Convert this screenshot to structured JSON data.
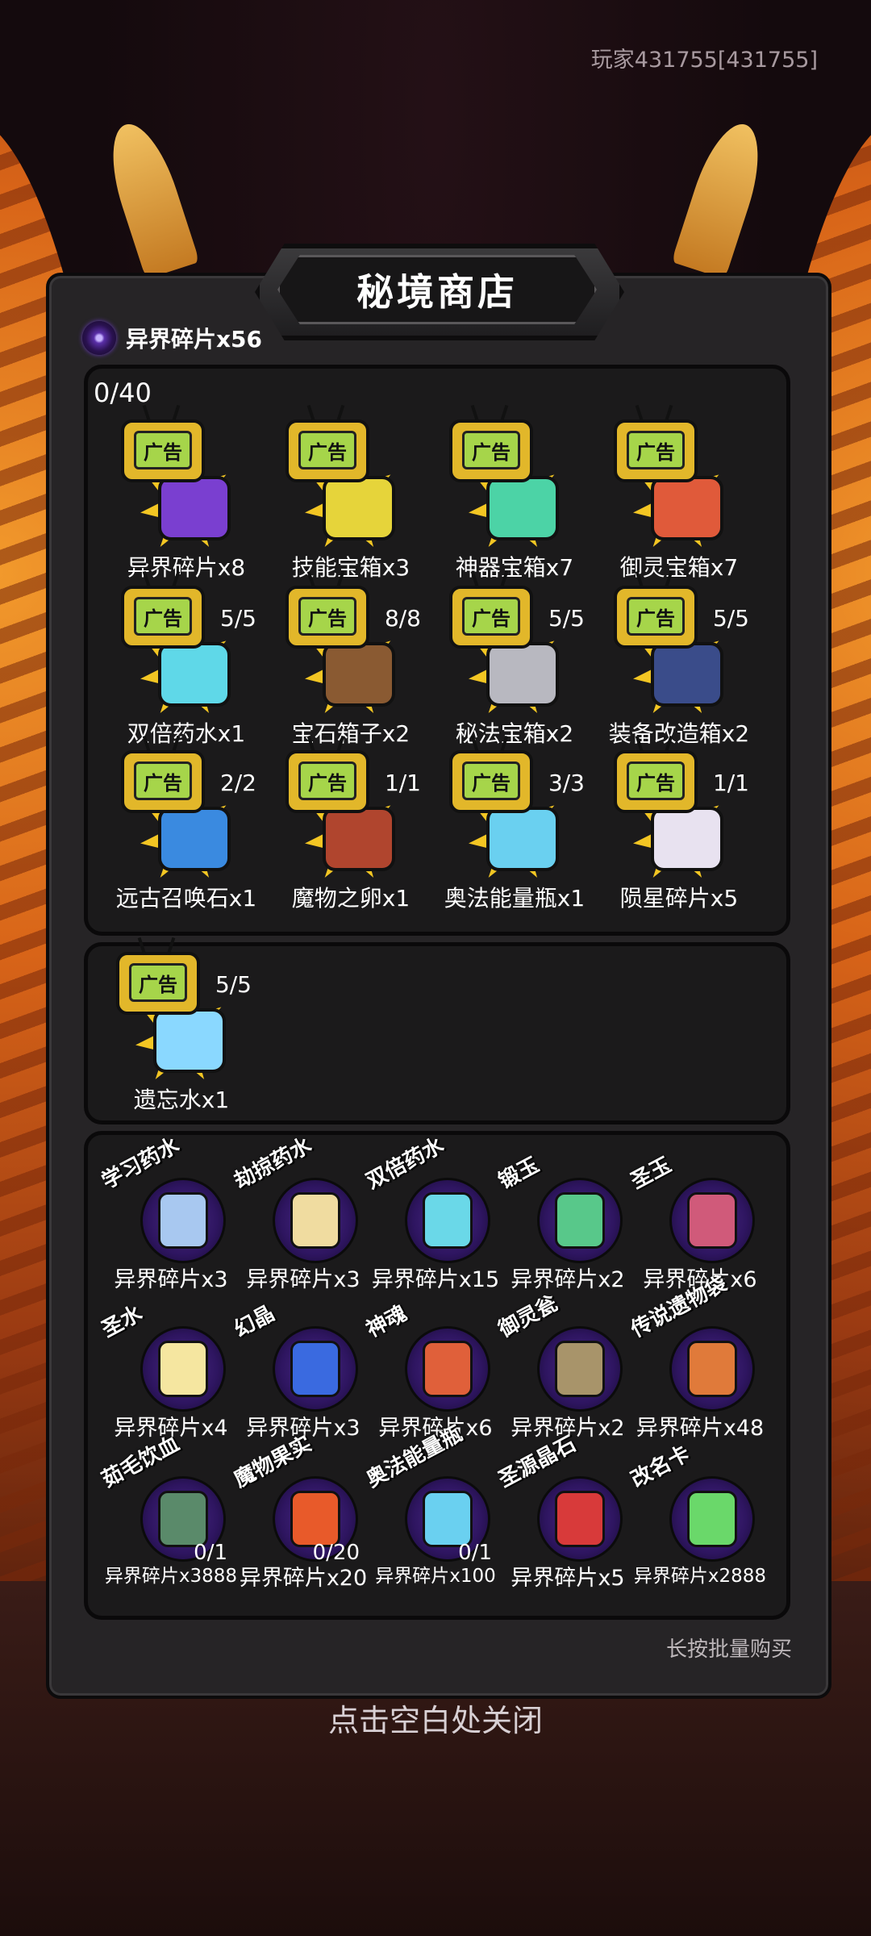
{
  "player": "玩家431755[431755]",
  "title": "秘境商店",
  "currency": {
    "label": "异界碎片x56"
  },
  "ad_section": {
    "counter": "0/40",
    "badge": "广告",
    "items": [
      {
        "name": "异界碎片x8",
        "qty": "",
        "color": "#7a3fd0"
      },
      {
        "name": "技能宝箱x3",
        "qty": "",
        "color": "#e6d43a"
      },
      {
        "name": "神器宝箱x7",
        "qty": "",
        "color": "#4cd3a6"
      },
      {
        "name": "御灵宝箱x7",
        "qty": "",
        "color": "#e05a3a"
      },
      {
        "name": "双倍药水x1",
        "qty": "5/5",
        "color": "#5fd8e8"
      },
      {
        "name": "宝石箱子x2",
        "qty": "8/8",
        "color": "#8a5a32"
      },
      {
        "name": "秘法宝箱x2",
        "qty": "5/5",
        "color": "#b8b8c0"
      },
      {
        "name": "装备改造箱x2",
        "qty": "5/5",
        "color": "#3a4c8a"
      },
      {
        "name": "远古召唤石x1",
        "qty": "2/2",
        "color": "#3a8ae0"
      },
      {
        "name": "魔物之卵x1",
        "qty": "1/1",
        "color": "#b0452e"
      },
      {
        "name": "奥法能量瓶x1",
        "qty": "3/3",
        "color": "#6ad0f0"
      },
      {
        "name": "陨星碎片x5",
        "qty": "1/1",
        "color": "#e8e2f0"
      }
    ]
  },
  "ad_section2": {
    "items": [
      {
        "name": "遗忘水x1",
        "qty": "5/5",
        "color": "#8ad8ff"
      }
    ]
  },
  "shop_section": {
    "items": [
      {
        "tag": "学习药水",
        "price": "异界碎片x3",
        "stock": "",
        "color": "#a8c8f0"
      },
      {
        "tag": "劫掠药水",
        "price": "异界碎片x3",
        "stock": "",
        "color": "#f0dca0"
      },
      {
        "tag": "双倍药水",
        "price": "异界碎片x15",
        "stock": "",
        "color": "#6ad8e8"
      },
      {
        "tag": "锻玉",
        "price": "异界碎片x2",
        "stock": "",
        "color": "#58c88a"
      },
      {
        "tag": "圣玉",
        "price": "异界碎片x6",
        "stock": "",
        "color": "#d05a7a"
      },
      {
        "tag": "圣水",
        "price": "异界碎片x4",
        "stock": "",
        "color": "#f5e6a0"
      },
      {
        "tag": "幻晶",
        "price": "异界碎片x3",
        "stock": "",
        "color": "#3a6ae0"
      },
      {
        "tag": "神魂",
        "price": "异界碎片x6",
        "stock": "",
        "color": "#e0603a"
      },
      {
        "tag": "御灵瓮",
        "price": "异界碎片x2",
        "stock": "",
        "color": "#a8946a"
      },
      {
        "tag": "传说遗物袋",
        "price": "异界碎片x48",
        "stock": "",
        "color": "#e07a3a"
      },
      {
        "tag": "茹毛饮血",
        "price": "异界碎片x3888",
        "stock": "0/1",
        "color": "#5a8a6a"
      },
      {
        "tag": "魔物果实",
        "price": "异界碎片x20",
        "stock": "0/20",
        "color": "#e85a2a"
      },
      {
        "tag": "奥法能量瓶",
        "price": "异界碎片x100",
        "stock": "0/1",
        "color": "#6ad0f0"
      },
      {
        "tag": "圣源晶石",
        "price": "异界碎片x5",
        "stock": "",
        "color": "#d83a3a"
      },
      {
        "tag": "改名卡",
        "price": "异界碎片x2888",
        "stock": "",
        "color": "#6ad86a"
      }
    ]
  },
  "hint": "长按批量购买",
  "close_hint": "点击空白处关闭"
}
